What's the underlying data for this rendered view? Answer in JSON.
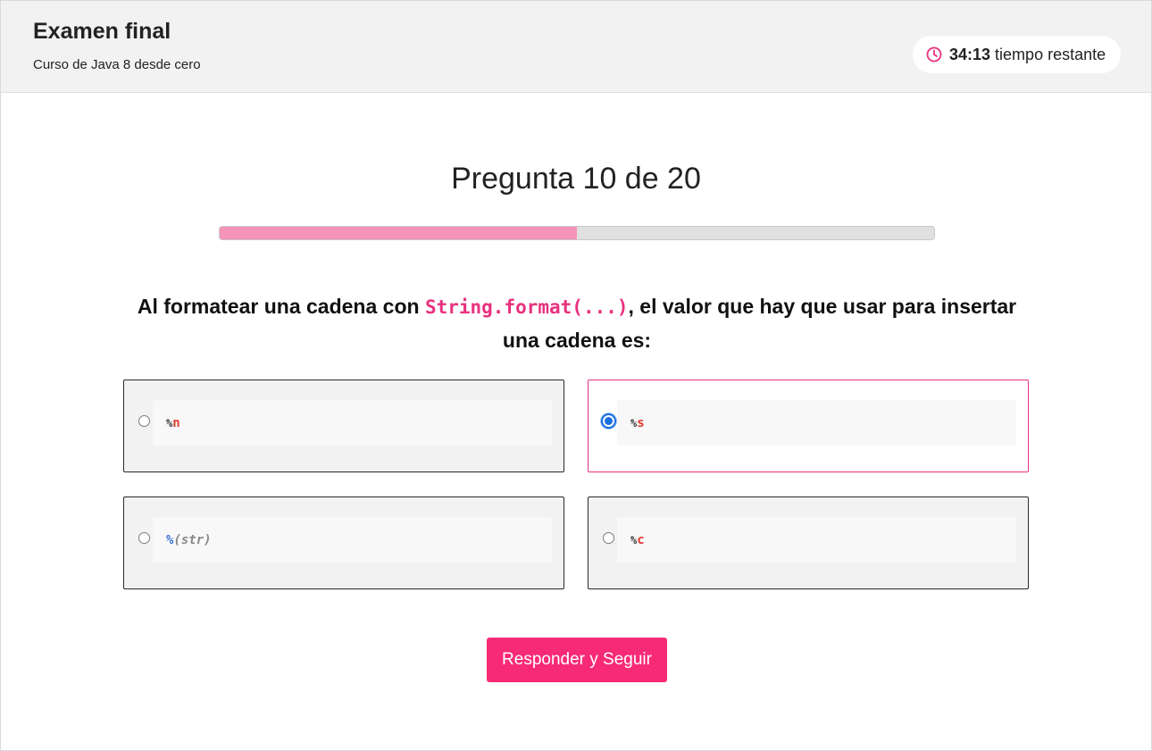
{
  "header": {
    "title": "Examen final",
    "course": "Curso de Java 8 desde cero",
    "timer": {
      "time": "34:13",
      "label": "tiempo restante",
      "icon": "clock-icon"
    }
  },
  "quiz": {
    "counter": "Pregunta 10 de 20",
    "progress_fraction": 0.5,
    "question_before": "Al formatear una cadena con ",
    "question_code": "String.format(...)",
    "question_after": ", el valor que hay que usar para insertar una cadena es:"
  },
  "options": [
    {
      "pct": "%",
      "value": "n",
      "selected": false
    },
    {
      "pct": "%",
      "value": "s",
      "selected": true
    },
    {
      "pct": "%",
      "value": "(str)",
      "selected": false
    },
    {
      "pct": "%",
      "value": "c",
      "selected": false
    }
  ],
  "submit_label": "Responder y Seguir",
  "colors": {
    "accent": "#f72a75",
    "progress_fill": "#f693b8",
    "selected_border": "#e8317f",
    "radio_selected": "#1a6fe0"
  }
}
